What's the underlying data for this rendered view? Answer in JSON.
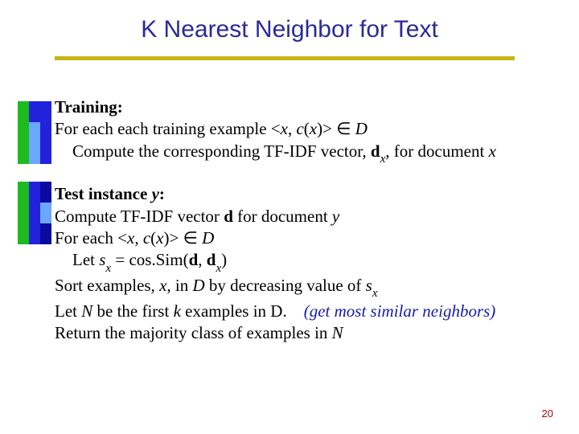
{
  "title": "K Nearest Neighbor for Text",
  "training": {
    "heading": "Training:",
    "line1_a": "For each each training example <",
    "line1_b": "x",
    "line1_c": ", ",
    "line1_d": "c",
    "line1_e": "(",
    "line1_f": "x",
    "line1_g": ")> ",
    "in": "∈",
    "line1_h": " ",
    "D": "D",
    "line2_a": "Compute the corresponding TF-IDF vector, ",
    "line2_b": "d",
    "line2_sub": "x",
    "line2_c": ", for document ",
    "line2_d": "x"
  },
  "test": {
    "heading": "Test instance ",
    "heading_y": "y",
    "heading_colon": ":",
    "l1_a": "Compute TF-IDF vector ",
    "l1_b": "d",
    "l1_c": " for document ",
    "l1_d": "y",
    "l2_a": "For each <",
    "l2_b": "x",
    "l2_c": ", ",
    "l2_d": "c",
    "l2_e": "(",
    "l2_f": "x",
    "l2_g": ")> ",
    "l2_in": "∈",
    "l2_sp": " ",
    "l2_D": "D",
    "l3_a": "Let ",
    "l3_b": "s",
    "l3_sub": "x",
    "l3_c": " = cos.Sim(",
    "l3_d": "d",
    "l3_e": ", ",
    "l3_f": "d",
    "l3_fs": "x",
    "l3_g": ")",
    "l4_a": "Sort examples, ",
    "l4_b": "x",
    "l4_c": ", in ",
    "l4_d": "D",
    "l4_e": " by decreasing value of ",
    "l4_f": "s",
    "l4_fs": "x",
    "l5_a": "Let ",
    "l5_b": "N",
    "l5_c": " be the first ",
    "l5_d": "k",
    "l5_e": " examples in D.    ",
    "l5_note": "(get most similar neighbors)",
    "l6_a": "Return the majority class of examples in ",
    "l6_b": "N"
  },
  "page_number": "20"
}
